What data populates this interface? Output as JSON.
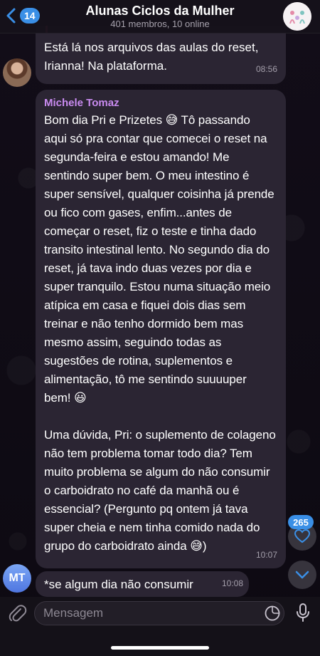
{
  "header": {
    "back_count": "14",
    "title": "Alunas Ciclos da Mulher",
    "subtitle": "401 membros, 10 online"
  },
  "messages": [
    {
      "text": "Está lá nos arquivos das aulas do reset, Irianna! Na plataforma.",
      "time": "08:56"
    },
    {
      "sender": "Michele Tomaz",
      "text": "Bom dia Pri e Prizetes 😅 Tô passando aqui só pra contar que comecei o reset na segunda-feira e estou amando! Me sentindo super bem. O meu intestino é super sensível, qualquer coisinha já prende ou fico com gases, enfim...antes de começar o reset, fiz o teste e tinha dado transito intestinal lento. No segundo dia do reset, já tava indo duas vezes por dia e super tranquilo. Estou numa situação meio atípica em casa e fiquei dois dias sem treinar e não tenho dormido bem mas mesmo assim, seguindo todas as sugestões de rotina, suplementos e alimentação, tô me sentindo suuuuper bem! 😃\n\nUma dúvida, Pri: o suplemento de colageno  não tem problema tomar todo dia? Tem muito problema se algum do não consumir o carboidrato no café da manhã ou é essencial? (Pergunto pq ontem já tava super cheia e nem tinha comido nada do grupo do carboidrato ainda 😅)",
      "time": "10:07"
    },
    {
      "avatar_initials": "MT",
      "text": "*se algum dia não consumir",
      "time": "10:08"
    }
  ],
  "floating": {
    "mention_count": "265"
  },
  "input": {
    "placeholder": "Mensagem"
  },
  "colors": {
    "accent": "#3a8fe6",
    "bubble": "#2b2533",
    "sender_name": "#c98bf0"
  },
  "icons": [
    "back-chevron-icon",
    "attach-icon",
    "sticker-icon",
    "microphone-icon",
    "heart-icon",
    "chevron-down-icon"
  ]
}
